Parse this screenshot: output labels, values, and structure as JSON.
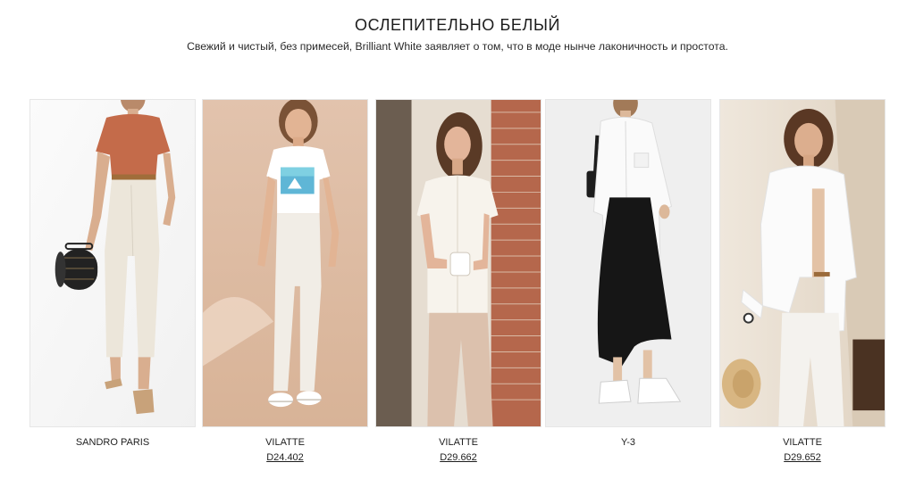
{
  "collection": {
    "title": "ОСЛЕПИТЕЛЬНО БЕЛЫЙ",
    "description": "Свежий и чистый, без примесей, Brilliant White заявляет о том, что в моде нынче лаконичность и простота."
  },
  "products": [
    {
      "brand": "SANDRO PARIS",
      "price": "",
      "image": "woman-rust-tee-white-jeans-photo"
    },
    {
      "brand": "VILATTE",
      "price": "D24.402",
      "image": "woman-white-print-tee-white-jeans-photo"
    },
    {
      "brand": "VILATTE",
      "price": "D29.662",
      "image": "woman-white-blouse-beige-trousers-photo"
    },
    {
      "brand": "Y-3",
      "price": "",
      "image": "woman-white-shirt-black-skirt-photo"
    },
    {
      "brand": "VILATTE",
      "price": "D29.652",
      "image": "woman-white-shirt-white-trousers-photo"
    }
  ]
}
